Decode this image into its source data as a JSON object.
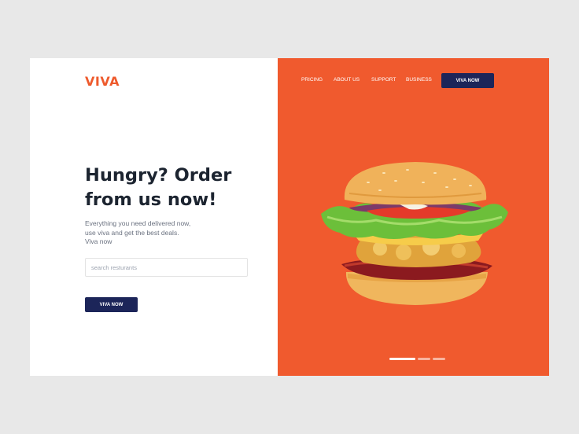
{
  "brand": {
    "name": "VIVA",
    "accent": "#f05a2e",
    "navy": "#1c2559"
  },
  "nav": {
    "items": [
      {
        "label": "PRICING"
      },
      {
        "label": "ABOUT US"
      },
      {
        "label": "SUPPORT"
      },
      {
        "label": "BUSINESS"
      }
    ],
    "cta_label": "VIVA NOW"
  },
  "hero": {
    "headline": "Hungry? Order from us now!",
    "subtext_lines": [
      "Everything you need delivered now,",
      "use viva and get the best deals.",
      "Viva now"
    ],
    "search_placeholder": "search resturants",
    "cta_label": "VIVA NOW",
    "image_icon": "burger-image"
  },
  "carousel": {
    "total": 3,
    "active": 1
  }
}
